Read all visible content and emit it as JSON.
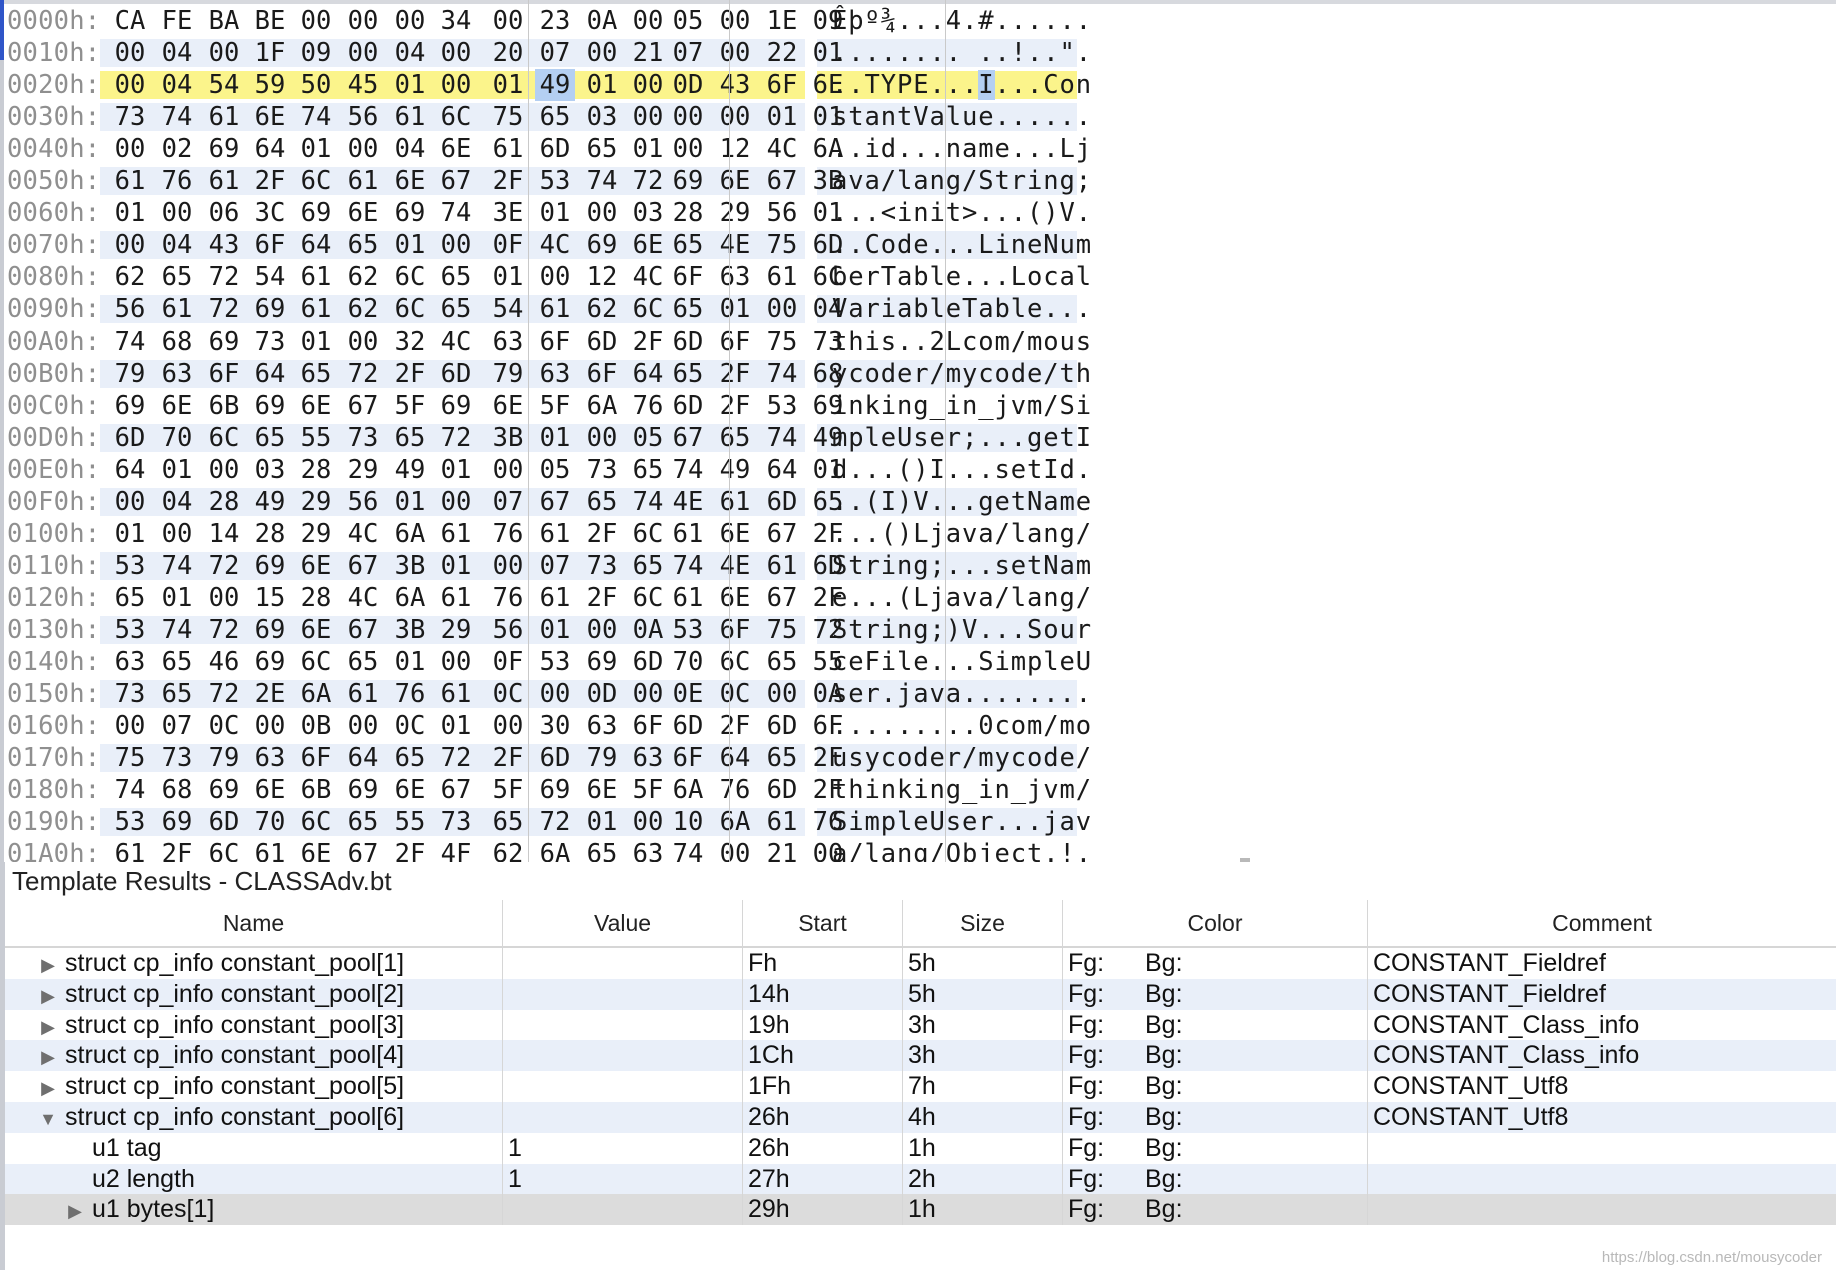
{
  "hex_view": {
    "rows": [
      {
        "addr": "0000h:",
        "bytes": [
          "CA",
          "FE",
          "BA",
          "BE",
          "00",
          "00",
          "00",
          "34",
          "00",
          "23",
          "0A",
          "00",
          "05",
          "00",
          "1E",
          "09"
        ],
        "ascii": "Êþº¾...4.#......"
      },
      {
        "addr": "0010h:",
        "bytes": [
          "00",
          "04",
          "00",
          "1F",
          "09",
          "00",
          "04",
          "00",
          "20",
          "07",
          "00",
          "21",
          "07",
          "00",
          "22",
          "01"
        ],
        "ascii": "........ ..!..\"."
      },
      {
        "addr": "0020h:",
        "bytes": [
          "00",
          "04",
          "54",
          "59",
          "50",
          "45",
          "01",
          "00",
          "01",
          "49",
          "01",
          "00",
          "0D",
          "43",
          "6F",
          "6E"
        ],
        "ascii": "..TYPE...I...Con",
        "highlighted": true,
        "selected_byte": 9
      },
      {
        "addr": "0030h:",
        "bytes": [
          "73",
          "74",
          "61",
          "6E",
          "74",
          "56",
          "61",
          "6C",
          "75",
          "65",
          "03",
          "00",
          "00",
          "00",
          "01",
          "01"
        ],
        "ascii": "stantValue......"
      },
      {
        "addr": "0040h:",
        "bytes": [
          "00",
          "02",
          "69",
          "64",
          "01",
          "00",
          "04",
          "6E",
          "61",
          "6D",
          "65",
          "01",
          "00",
          "12",
          "4C",
          "6A"
        ],
        "ascii": "..id...name...Lj"
      },
      {
        "addr": "0050h:",
        "bytes": [
          "61",
          "76",
          "61",
          "2F",
          "6C",
          "61",
          "6E",
          "67",
          "2F",
          "53",
          "74",
          "72",
          "69",
          "6E",
          "67",
          "3B"
        ],
        "ascii": "ava/lang/String;"
      },
      {
        "addr": "0060h:",
        "bytes": [
          "01",
          "00",
          "06",
          "3C",
          "69",
          "6E",
          "69",
          "74",
          "3E",
          "01",
          "00",
          "03",
          "28",
          "29",
          "56",
          "01"
        ],
        "ascii": "...<init>...()V."
      },
      {
        "addr": "0070h:",
        "bytes": [
          "00",
          "04",
          "43",
          "6F",
          "64",
          "65",
          "01",
          "00",
          "0F",
          "4C",
          "69",
          "6E",
          "65",
          "4E",
          "75",
          "6D"
        ],
        "ascii": "..Code...LineNum"
      },
      {
        "addr": "0080h:",
        "bytes": [
          "62",
          "65",
          "72",
          "54",
          "61",
          "62",
          "6C",
          "65",
          "01",
          "00",
          "12",
          "4C",
          "6F",
          "63",
          "61",
          "6C"
        ],
        "ascii": "berTable...Local"
      },
      {
        "addr": "0090h:",
        "bytes": [
          "56",
          "61",
          "72",
          "69",
          "61",
          "62",
          "6C",
          "65",
          "54",
          "61",
          "62",
          "6C",
          "65",
          "01",
          "00",
          "04"
        ],
        "ascii": "VariableTable..."
      },
      {
        "addr": "00A0h:",
        "bytes": [
          "74",
          "68",
          "69",
          "73",
          "01",
          "00",
          "32",
          "4C",
          "63",
          "6F",
          "6D",
          "2F",
          "6D",
          "6F",
          "75",
          "73"
        ],
        "ascii": "this..2Lcom/mous"
      },
      {
        "addr": "00B0h:",
        "bytes": [
          "79",
          "63",
          "6F",
          "64",
          "65",
          "72",
          "2F",
          "6D",
          "79",
          "63",
          "6F",
          "64",
          "65",
          "2F",
          "74",
          "68"
        ],
        "ascii": "ycoder/mycode/th"
      },
      {
        "addr": "00C0h:",
        "bytes": [
          "69",
          "6E",
          "6B",
          "69",
          "6E",
          "67",
          "5F",
          "69",
          "6E",
          "5F",
          "6A",
          "76",
          "6D",
          "2F",
          "53",
          "69"
        ],
        "ascii": "inking_in_jvm/Si"
      },
      {
        "addr": "00D0h:",
        "bytes": [
          "6D",
          "70",
          "6C",
          "65",
          "55",
          "73",
          "65",
          "72",
          "3B",
          "01",
          "00",
          "05",
          "67",
          "65",
          "74",
          "49"
        ],
        "ascii": "mpleUser;...getI"
      },
      {
        "addr": "00E0h:",
        "bytes": [
          "64",
          "01",
          "00",
          "03",
          "28",
          "29",
          "49",
          "01",
          "00",
          "05",
          "73",
          "65",
          "74",
          "49",
          "64",
          "01"
        ],
        "ascii": "d...()I...setId."
      },
      {
        "addr": "00F0h:",
        "bytes": [
          "00",
          "04",
          "28",
          "49",
          "29",
          "56",
          "01",
          "00",
          "07",
          "67",
          "65",
          "74",
          "4E",
          "61",
          "6D",
          "65"
        ],
        "ascii": "..(I)V...getName"
      },
      {
        "addr": "0100h:",
        "bytes": [
          "01",
          "00",
          "14",
          "28",
          "29",
          "4C",
          "6A",
          "61",
          "76",
          "61",
          "2F",
          "6C",
          "61",
          "6E",
          "67",
          "2F"
        ],
        "ascii": "...()Ljava/lang/"
      },
      {
        "addr": "0110h:",
        "bytes": [
          "53",
          "74",
          "72",
          "69",
          "6E",
          "67",
          "3B",
          "01",
          "00",
          "07",
          "73",
          "65",
          "74",
          "4E",
          "61",
          "6D"
        ],
        "ascii": "String;...setNam"
      },
      {
        "addr": "0120h:",
        "bytes": [
          "65",
          "01",
          "00",
          "15",
          "28",
          "4C",
          "6A",
          "61",
          "76",
          "61",
          "2F",
          "6C",
          "61",
          "6E",
          "67",
          "2F"
        ],
        "ascii": "e...(Ljava/lang/"
      },
      {
        "addr": "0130h:",
        "bytes": [
          "53",
          "74",
          "72",
          "69",
          "6E",
          "67",
          "3B",
          "29",
          "56",
          "01",
          "00",
          "0A",
          "53",
          "6F",
          "75",
          "72"
        ],
        "ascii": "String;)V...Sour"
      },
      {
        "addr": "0140h:",
        "bytes": [
          "63",
          "65",
          "46",
          "69",
          "6C",
          "65",
          "01",
          "00",
          "0F",
          "53",
          "69",
          "6D",
          "70",
          "6C",
          "65",
          "55"
        ],
        "ascii": "ceFile...SimpleU"
      },
      {
        "addr": "0150h:",
        "bytes": [
          "73",
          "65",
          "72",
          "2E",
          "6A",
          "61",
          "76",
          "61",
          "0C",
          "00",
          "0D",
          "00",
          "0E",
          "0C",
          "00",
          "0A"
        ],
        "ascii": "ser.java........"
      },
      {
        "addr": "0160h:",
        "bytes": [
          "00",
          "07",
          "0C",
          "00",
          "0B",
          "00",
          "0C",
          "01",
          "00",
          "30",
          "63",
          "6F",
          "6D",
          "2F",
          "6D",
          "6F"
        ],
        "ascii": ".........0com/mo"
      },
      {
        "addr": "0170h:",
        "bytes": [
          "75",
          "73",
          "79",
          "63",
          "6F",
          "64",
          "65",
          "72",
          "2F",
          "6D",
          "79",
          "63",
          "6F",
          "64",
          "65",
          "2F"
        ],
        "ascii": "usycoder/mycode/"
      },
      {
        "addr": "0180h:",
        "bytes": [
          "74",
          "68",
          "69",
          "6E",
          "6B",
          "69",
          "6E",
          "67",
          "5F",
          "69",
          "6E",
          "5F",
          "6A",
          "76",
          "6D",
          "2F"
        ],
        "ascii": "thinking_in_jvm/"
      },
      {
        "addr": "0190h:",
        "bytes": [
          "53",
          "69",
          "6D",
          "70",
          "6C",
          "65",
          "55",
          "73",
          "65",
          "72",
          "01",
          "00",
          "10",
          "6A",
          "61",
          "76"
        ],
        "ascii": "SimpleUser...jav"
      },
      {
        "addr": "01A0h:",
        "bytes": [
          "61",
          "2F",
          "6C",
          "61",
          "6E",
          "67",
          "2F",
          "4F",
          "62",
          "6A",
          "65",
          "63",
          "74",
          "00",
          "21",
          "00"
        ],
        "ascii": "a/lang/Object.!."
      }
    ]
  },
  "template_results": {
    "title": "Template Results - CLASSAdv.bt",
    "columns": [
      "Name",
      "Value",
      "Start",
      "Size",
      "Color",
      "Comment"
    ],
    "rows": [
      {
        "expander": "▶",
        "indent": 0,
        "name": "struct cp_info constant_pool[1]",
        "value": "",
        "start": "Fh",
        "size": "5h",
        "fg": "Fg:",
        "bg": "Bg:",
        "comment": "CONSTANT_Fieldref"
      },
      {
        "expander": "▶",
        "indent": 0,
        "name": "struct cp_info constant_pool[2]",
        "value": "",
        "start": "14h",
        "size": "5h",
        "fg": "Fg:",
        "bg": "Bg:",
        "comment": "CONSTANT_Fieldref"
      },
      {
        "expander": "▶",
        "indent": 0,
        "name": "struct cp_info constant_pool[3]",
        "value": "",
        "start": "19h",
        "size": "3h",
        "fg": "Fg:",
        "bg": "Bg:",
        "comment": "CONSTANT_Class_info"
      },
      {
        "expander": "▶",
        "indent": 0,
        "name": "struct cp_info constant_pool[4]",
        "value": "",
        "start": "1Ch",
        "size": "3h",
        "fg": "Fg:",
        "bg": "Bg:",
        "comment": "CONSTANT_Class_info"
      },
      {
        "expander": "▶",
        "indent": 0,
        "name": "struct cp_info constant_pool[5]",
        "value": "",
        "start": "1Fh",
        "size": "7h",
        "fg": "Fg:",
        "bg": "Bg:",
        "comment": "CONSTANT_Utf8"
      },
      {
        "expander": "▼",
        "indent": 0,
        "name": "struct cp_info constant_pool[6]",
        "value": "",
        "start": "26h",
        "size": "4h",
        "fg": "Fg:",
        "bg": "Bg:",
        "comment": "CONSTANT_Utf8"
      },
      {
        "expander": "",
        "indent": 1,
        "name": "u1 tag",
        "value": "1",
        "start": "26h",
        "size": "1h",
        "fg": "Fg:",
        "bg": "Bg:",
        "comment": ""
      },
      {
        "expander": "",
        "indent": 1,
        "name": "u2 length",
        "value": "1",
        "start": "27h",
        "size": "2h",
        "fg": "Fg:",
        "bg": "Bg:",
        "comment": ""
      },
      {
        "expander": "▶",
        "indent": 1,
        "name": "u1 bytes[1]",
        "value": "",
        "start": "29h",
        "size": "1h",
        "fg": "Fg:",
        "bg": "Bg:",
        "comment": "",
        "selected": true
      }
    ]
  },
  "watermark": "https://blog.csdn.net/mousycoder",
  "colors": {
    "row_band": "#e9eff9",
    "highlight_row": "#fbf48b",
    "selected_byte": "#b4cff2",
    "selected_row": "#dcdcdc",
    "address_text": "#8f8f8f"
  }
}
